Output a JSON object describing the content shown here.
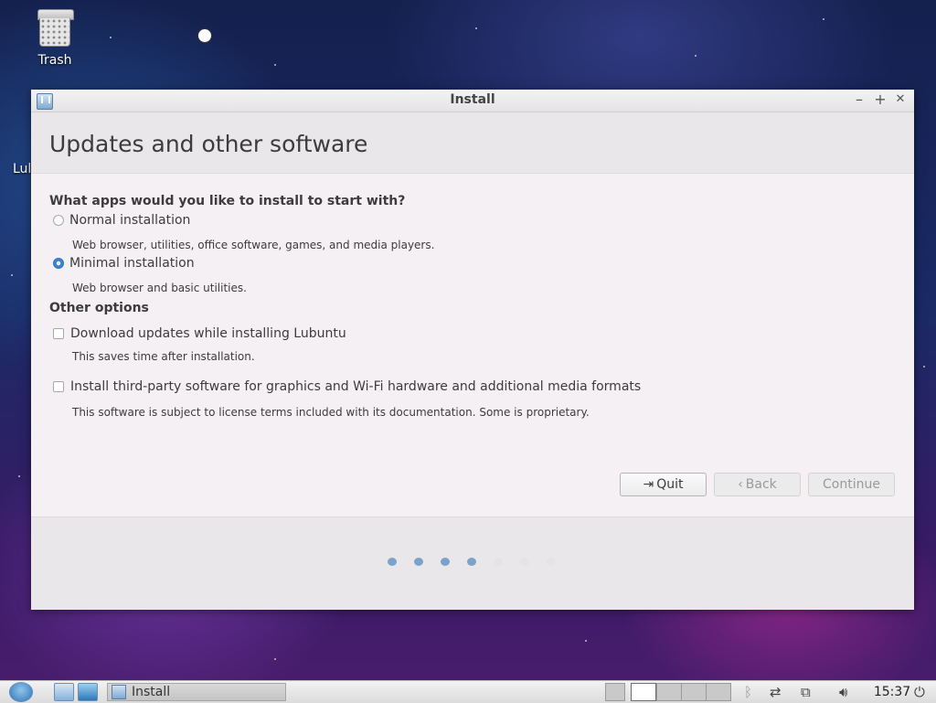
{
  "desktop": {
    "trash_label": "Trash",
    "partial_label": "Lul"
  },
  "window": {
    "title": "Install",
    "controls": {
      "minimize": "–",
      "maximize": "+",
      "close": "✕"
    },
    "heading": "Updates and other software",
    "question": "What apps would you like to install to start with?",
    "install_options": [
      {
        "label": "Normal installation",
        "description": "Web browser, utilities, office software, games, and media players.",
        "selected": false
      },
      {
        "label": "Minimal installation",
        "description": "Web browser and basic utilities.",
        "selected": true
      }
    ],
    "other_heading": "Other options",
    "other_options": [
      {
        "label": "Download updates while installing Lubuntu",
        "description": "This saves time after installation.",
        "checked": false
      },
      {
        "label": "Install third-party software for graphics and Wi-Fi hardware and additional media formats",
        "description": "This software is subject to license terms included with its documentation. Some is proprietary.",
        "checked": false
      }
    ],
    "buttons": {
      "quit": "Quit",
      "back": "Back",
      "continue": "Continue"
    },
    "progress": {
      "total_steps": 7,
      "completed_steps": 4
    }
  },
  "taskbar": {
    "task_label": "Install",
    "clock": "15:37",
    "icons": [
      "menu-icon",
      "file-manager-icon",
      "browser-icon",
      "bluetooth-icon",
      "network-icon",
      "display-icon",
      "volume-icon",
      "power-icon"
    ]
  },
  "colors": {
    "accent": "#3a84d6",
    "progress_done": "#7ba3c9"
  }
}
